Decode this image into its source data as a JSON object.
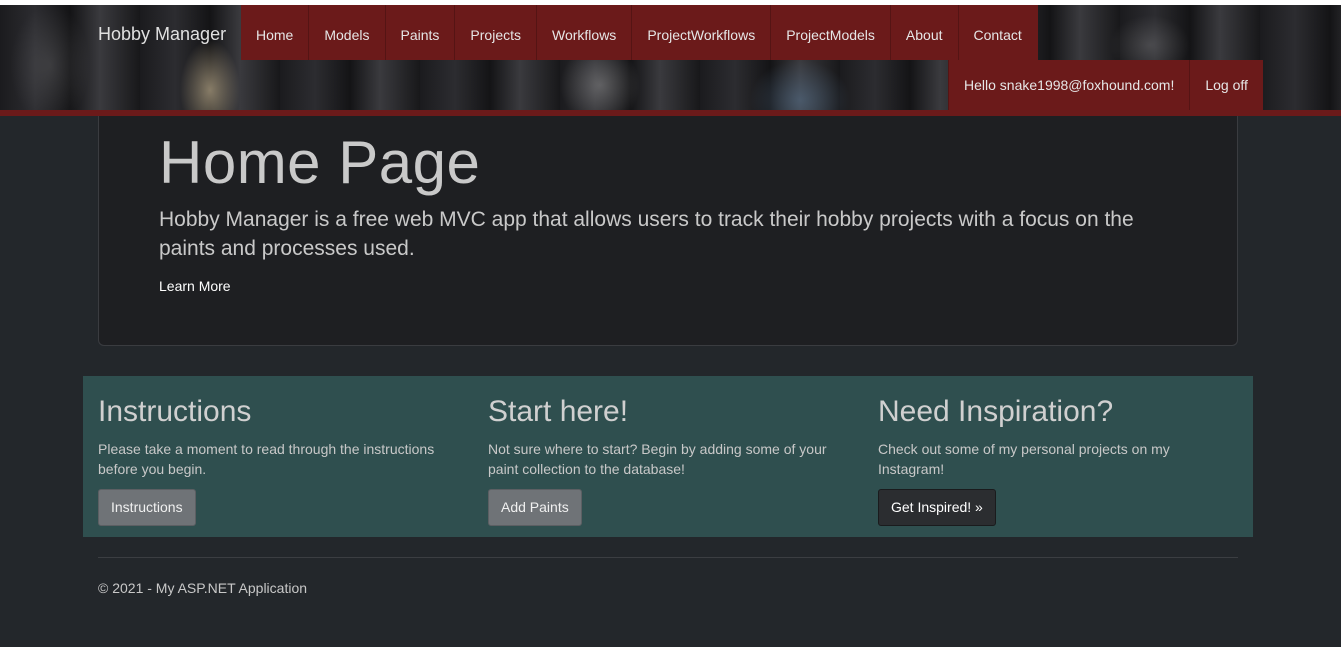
{
  "brand": "Hobby Manager",
  "nav": [
    {
      "label": "Home"
    },
    {
      "label": "Models"
    },
    {
      "label": "Paints"
    },
    {
      "label": "Projects"
    },
    {
      "label": "Workflows"
    },
    {
      "label": "ProjectWorkflows"
    },
    {
      "label": "ProjectModels"
    },
    {
      "label": "About"
    },
    {
      "label": "Contact"
    }
  ],
  "user": {
    "greeting": "Hello snake1998@foxhound.com!",
    "logoff": "Log off"
  },
  "jumbotron": {
    "title": "Home Page",
    "lead": "Hobby Manager is a free web MVC app that allows users to track their hobby projects with a focus on the paints and processes used.",
    "learn_more": "Learn More"
  },
  "features": [
    {
      "title": "Instructions",
      "text": "Please take a moment to read through the instructions before you begin.",
      "button": "Instructions"
    },
    {
      "title": "Start here!",
      "text": "Not sure where to start? Begin by adding some of your paint collection to the database!",
      "button": "Add Paints"
    },
    {
      "title": "Need Inspiration?",
      "text": "Check out some of my personal projects on my Instagram!",
      "button": "Get Inspired! »"
    }
  ],
  "footer": "© 2021 - My ASP.NET Application",
  "colors": {
    "nav_bg": "#6b1a1a",
    "body_bg": "#23272b",
    "feature_bg": "#2f4f4f"
  }
}
